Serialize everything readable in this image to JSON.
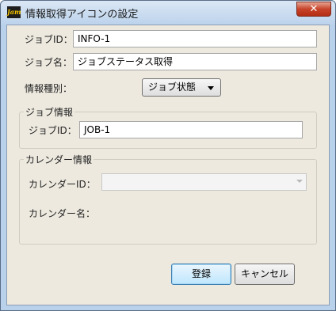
{
  "window": {
    "title": "情報取得アイコンの設定",
    "app_icon_text": "Jam",
    "close_glyph": "✕"
  },
  "form": {
    "job_id_label": "ジョブID：",
    "job_id_value": "INFO-1",
    "job_name_label": "ジョブ名：",
    "job_name_value": "ジョブステータス取得",
    "info_type_label": "情報種別：",
    "info_type_value": "ジョブ状態"
  },
  "job_info_group": {
    "title": "ジョブ情報",
    "job_id_label": "ジョブID：",
    "job_id_value": "JOB-1"
  },
  "calendar_group": {
    "title": "カレンダー情報",
    "calendar_id_label": "カレンダーID：",
    "calendar_id_value": "",
    "calendar_name_label": "カレンダー名："
  },
  "buttons": {
    "register": "登録",
    "cancel": "キャンセル"
  }
}
